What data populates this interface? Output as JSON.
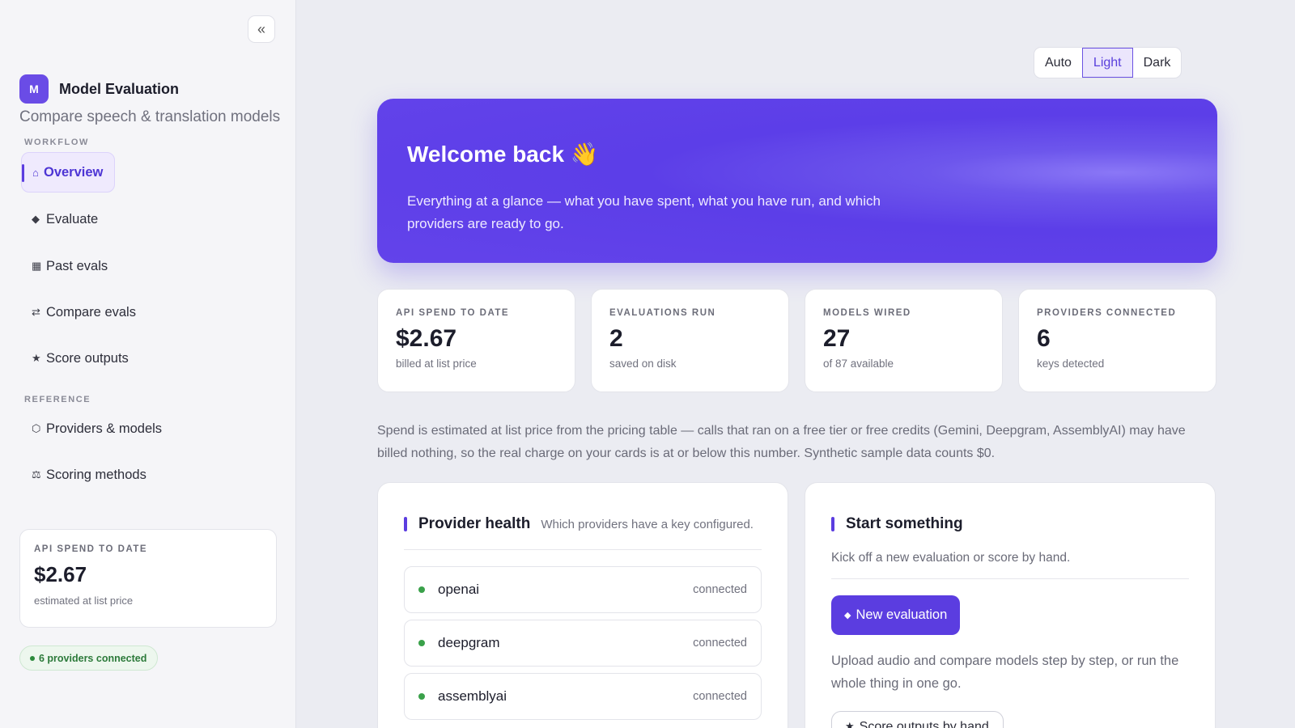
{
  "sidebar": {
    "collapse_icon": "«",
    "brand_initial": "M",
    "brand_title": "Model Evaluation",
    "brand_subtitle": "Compare speech & translation models",
    "workflow_label": "WORKFLOW",
    "workflow_items": [
      {
        "icon": "⌂",
        "label": "Overview",
        "active": true
      },
      {
        "icon": "◆",
        "label": "Evaluate"
      },
      {
        "icon": "▦",
        "label": "Past evals"
      },
      {
        "icon": "⇄",
        "label": "Compare evals"
      },
      {
        "icon": "★",
        "label": "Score outputs"
      }
    ],
    "reference_label": "REFERENCE",
    "reference_items": [
      {
        "icon": "⬡",
        "label": "Providers & models"
      },
      {
        "icon": "⚖",
        "label": "Scoring methods"
      }
    ],
    "spend_card": {
      "label": "API SPEND TO DATE",
      "value": "$2.67",
      "sub": "estimated at list price"
    },
    "providers_pill": "6 providers connected"
  },
  "theme_toggle": {
    "options": [
      "Auto",
      "Light",
      "Dark"
    ],
    "selected": "Light"
  },
  "hero": {
    "title": "Welcome back 👋",
    "text": "Everything at a glance — what you have spent, what you have run, and which providers are ready to go."
  },
  "stats": [
    {
      "label": "API SPEND TO DATE",
      "value": "$2.67",
      "sub": "billed at list price"
    },
    {
      "label": "EVALUATIONS RUN",
      "value": "2",
      "sub": "saved on disk"
    },
    {
      "label": "MODELS WIRED",
      "value": "27",
      "sub": "of 87 available"
    },
    {
      "label": "PROVIDERS CONNECTED",
      "value": "6",
      "sub": "keys detected"
    }
  ],
  "note": "Spend is estimated at list price from the pricing table — calls that ran on a free tier or free credits (Gemini, Deepgram, AssemblyAI) may have billed nothing, so the real charge on your cards is at or below this number. Synthetic sample data counts $0.",
  "provider_health": {
    "title": "Provider health",
    "hint": "Which providers have a key configured.",
    "providers": [
      {
        "name": "openai",
        "status": "connected"
      },
      {
        "name": "deepgram",
        "status": "connected"
      },
      {
        "name": "assemblyai",
        "status": "connected"
      }
    ]
  },
  "start_something": {
    "title": "Start something",
    "subtitle": "Kick off a new evaluation or score by hand.",
    "new_eval_icon": "◆",
    "new_eval_label": "New evaluation",
    "text": "Upload audio and compare models step by step, or run the whole thing in one go.",
    "score_icon": "★",
    "score_label": "Score outputs by hand"
  }
}
